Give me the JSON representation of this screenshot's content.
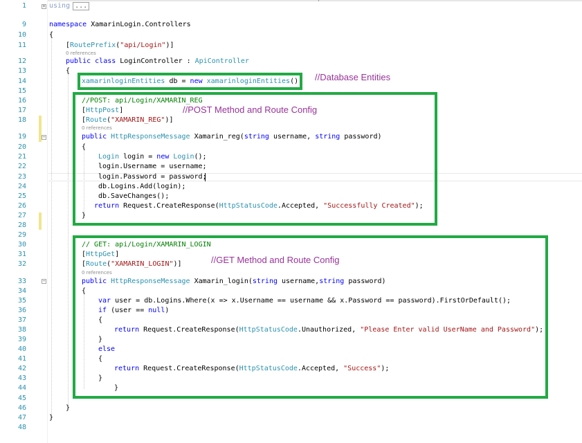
{
  "line_numbers": [
    "1",
    "9",
    "10",
    "11",
    "12",
    "13",
    "14",
    "15",
    "16",
    "17",
    "18",
    "19",
    "20",
    "21",
    "22",
    "23",
    "24",
    "25",
    "26",
    "27",
    "28",
    "29",
    "30",
    "31",
    "32",
    "33",
    "34",
    "35",
    "36",
    "37",
    "38",
    "39",
    "40",
    "41",
    "42",
    "43",
    "44",
    "45",
    "46",
    "47",
    "48"
  ],
  "fold_symbol_plus": "+",
  "fold_symbol_minus": "−",
  "code": {
    "using_kw": "using",
    "using_collapsed": "...",
    "namespace_kw": "namespace",
    "namespace_name": " XamarinLogin.Controllers",
    "open_brace": "{",
    "close_brace": "}",
    "route_prefix_attr": "RoutePrefix",
    "route_prefix_open": "[",
    "route_prefix_val": "\"api/Login\"",
    "route_prefix_close": ")]",
    "paren_open": "(",
    "refs": "0 references",
    "public_kw": "public",
    "class_kw": "class",
    "class_name": " LoginController : ",
    "api_controller": "ApiController",
    "db_type": "xamarinloginEntities",
    "db_rest": " db = ",
    "new_kw": "new",
    "db_ctor": "xamarinloginEntities",
    "db_end": "();",
    "post_comment": "//POST: api/Login/XAMARIN_REG",
    "http_post": "HttpPost",
    "route_attr": "Route",
    "route_reg_val": "\"XAMARIN_REG\"",
    "http_resp_msg": "HttpResponseMessage",
    "reg_sig_a": " Xamarin_reg(",
    "string_kw": "string",
    "reg_sig_b": " username, ",
    "reg_sig_c": " password)",
    "login_type": "Login",
    "login_decl_a": " login = ",
    "login_decl_b": "();",
    "login_username": "login.Username = username;",
    "login_password": "login.Password = password;",
    "db_add": "db.Logins.Add(login);",
    "db_save": "db.SaveChanges();",
    "return_kw": "return",
    "create_resp": " Request.CreateResponse(",
    "status_code": "HttpStatusCode",
    "accepted": ".Accepted, ",
    "success_created": "\"Successfully Created\"",
    "resp_end": ");",
    "get_comment": "// GET: api/Login/XAMARIN_LOGIN",
    "http_get": "HttpGet",
    "route_login_val": "\"XAMARIN_LOGIN\"",
    "login_sig_a": " Xamarin_login(",
    "login_sig_b": " username,",
    "var_kw": "var",
    "user_query": " user = db.Logins.Where(x => x.Username == username && x.Password == password).FirstOrDefault();",
    "if_kw": "if",
    "if_cond_a": " (user == ",
    "null_kw": "null",
    "if_cond_b": ")",
    "unauthorized": ".Unauthorized, ",
    "invalid_msg": "\"Please Enter valid UserName and Password\"",
    "else_kw": "else",
    "success": "\"Success\""
  },
  "annotations": {
    "db_entities": "//Database Entities",
    "post_method": "//POST Method and Route Config",
    "get_method": "//GET Method and Route Config"
  },
  "colors": {
    "keyword": "#0000ff",
    "type": "#2b91af",
    "string": "#a31515",
    "comment": "#008000",
    "highlight_box": "#22aa44",
    "annotation": "#993399",
    "line_number": "#2b91af"
  }
}
